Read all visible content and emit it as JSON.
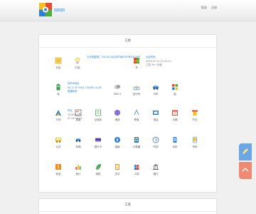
{
  "header": {
    "site_name": "四四四",
    "links": [
      "登录",
      "注册"
    ]
  },
  "main_panel": {
    "title": "工具"
  },
  "second_panel": {
    "title": "工具"
  },
  "info": {
    "ad_line": "今天是星期二 06:18:54北京时间2009年6月26日",
    "date_caption": "北京时间",
    "date_value": "2009-07-22 21:29:11",
    "date_extra": "江苏 29~35度",
    "ip_caption": "你的IP地址",
    "ip_value": "92.17.87.96/17.09/80.14.36",
    "ip_extra": "联通机房",
    "time_caption": "时区",
    "time_value": "1008-0101",
    "time_extra": "07-18 10:42"
  },
  "grid": [
    {
      "name": "calendar-icon",
      "label": "日历"
    },
    {
      "name": "bulb-icon",
      "label": "灯泡"
    },
    {
      "name": "book-icon",
      "label": "书"
    },
    {
      "name": "battery-icon",
      "label": "电"
    },
    {
      "name": "pm25-icon",
      "label": "PM2.5"
    },
    {
      "name": "bike-icon",
      "label": "自行车"
    },
    {
      "name": "car-icon",
      "label": "汽车"
    },
    {
      "name": "ship-icon",
      "label": "船"
    },
    {
      "name": "blocks-icon",
      "label": "方块"
    },
    {
      "name": "abacus-icon",
      "label": "算盘"
    },
    {
      "name": "notebook-icon",
      "label": "记事本"
    },
    {
      "name": "globe-icon",
      "label": "地球"
    },
    {
      "name": "compass-icon",
      "label": "罗盘"
    },
    {
      "name": "phone-icon",
      "label": "电话"
    },
    {
      "name": "datebook-icon",
      "label": "日期"
    },
    {
      "name": "festival-icon",
      "label": "节日"
    },
    {
      "name": "bus-icon",
      "label": "公交"
    },
    {
      "name": "car2-icon",
      "label": "车辆"
    },
    {
      "name": "card-icon",
      "label": "银行卡"
    },
    {
      "name": "compass2-icon",
      "label": "指南"
    },
    {
      "name": "calc-icon",
      "label": "计算器"
    },
    {
      "name": "clock-icon",
      "label": "时钟"
    },
    {
      "name": "mobile-icon",
      "label": "手机"
    },
    {
      "name": "mobile2-icon",
      "label": "号码"
    },
    {
      "name": "warning-icon",
      "label": "安全"
    },
    {
      "name": "chart-icon",
      "label": "统计"
    },
    {
      "name": "leaf-icon",
      "label": "绿色"
    },
    {
      "name": "book2-icon",
      "label": "文字"
    },
    {
      "name": "people-icon",
      "label": "人物"
    },
    {
      "name": "bank-icon",
      "label": "银行"
    }
  ],
  "colors": {
    "accent": "#2a8ad8",
    "side_up": "#6aa7e6",
    "side_down": "#ef8a72"
  }
}
